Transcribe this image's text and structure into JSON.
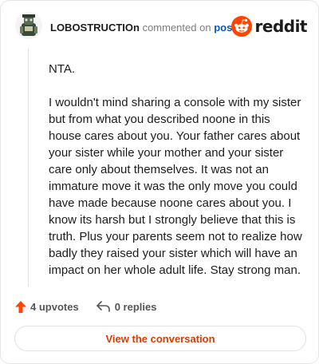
{
  "header": {
    "username": "LOBOSTRUCTIOn",
    "action": "commented on",
    "post_link": "post",
    "brand": "reddit",
    "avatar_icon": "avatar-icon",
    "brand_icon": "reddit-snoo-icon"
  },
  "comment": {
    "paragraphs": [
      "NTA.",
      "I wouldn't mind sharing a console with my sister but from what you described noone in this house cares about you. Your father cares about your sister while your mother and your sister care only about themselves. It was not an immature move it was the only move you could have made because noone cares about you. I know its harsh but I strongly believe that this is truth. Plus your parents seem not to realize how badly they raised your sister which will have an impact on her whole adult life. Stay strong man."
    ]
  },
  "actions": {
    "upvotes": "4 upvotes",
    "replies": "0 replies",
    "upvote_icon": "upvote-arrow-icon",
    "reply_icon": "reply-arrow-icon"
  },
  "cta": {
    "label": "View the conversation"
  },
  "colors": {
    "accent": "#ff4500",
    "link": "#0a59b5",
    "cta": "#d93a00"
  }
}
